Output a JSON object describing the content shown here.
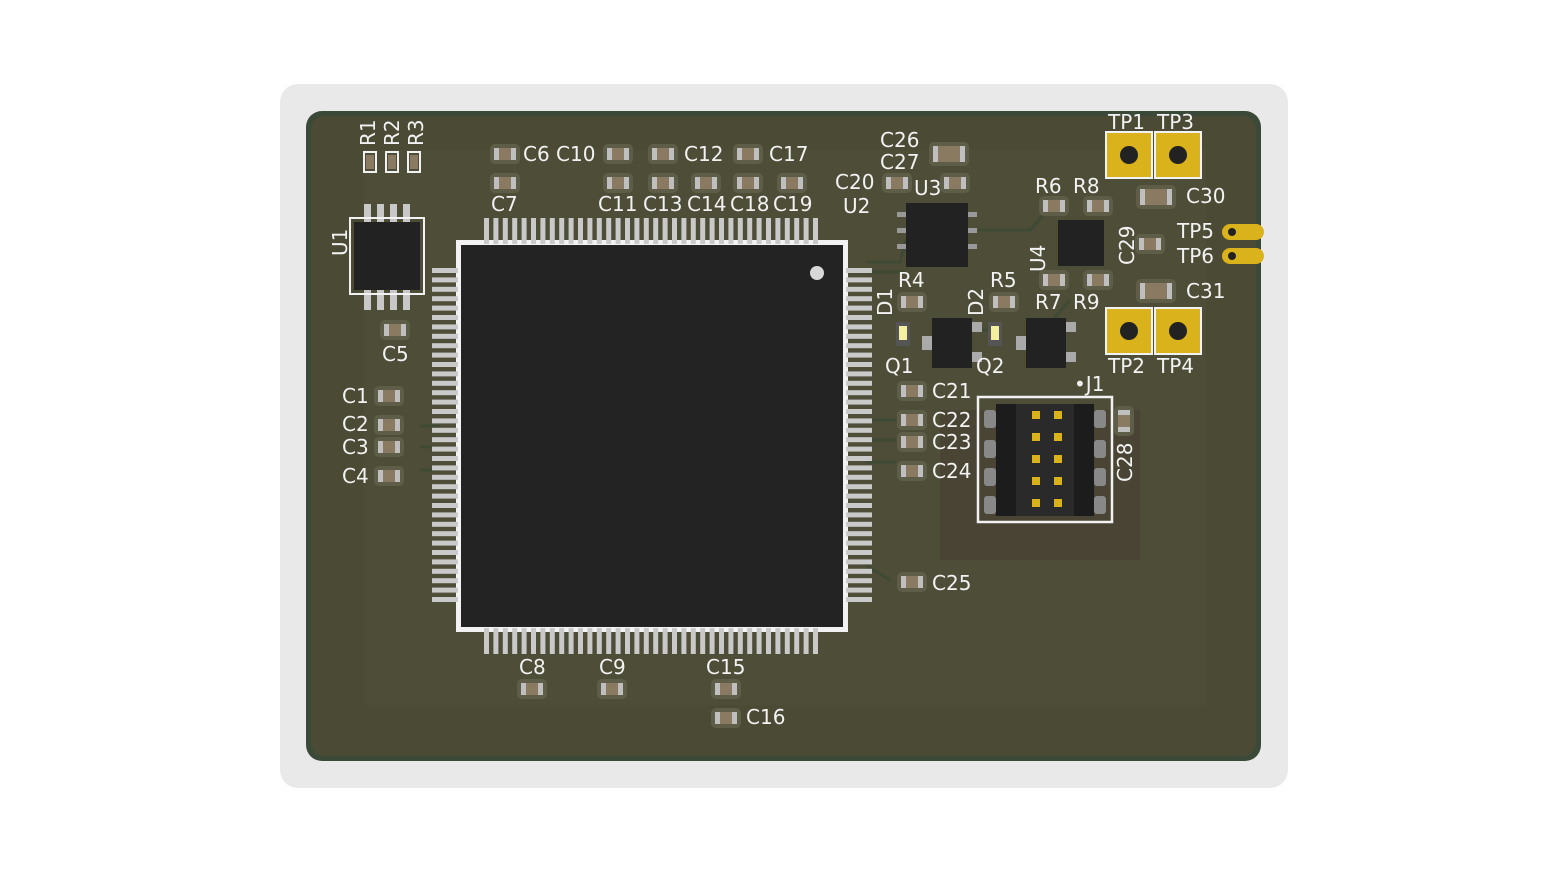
{
  "board": {
    "colors": {
      "background": "#ffffff",
      "shadow": "#e9e9e9",
      "soldermask": "#4a4a35",
      "mask_edge": "#3b4a38",
      "silkscreen": "#f2f2f2",
      "ic_body": "#222222",
      "copper_pad": "#d9b21c",
      "capacitor_body": "#8a7a62"
    },
    "designators": {
      "R1": "R1",
      "R2": "R2",
      "R3": "R3",
      "U1": "U1",
      "U2": "U2",
      "U3": "U3",
      "U4": "U4",
      "C1": "C1",
      "C2": "C2",
      "C3": "C3",
      "C4": "C4",
      "C5": "C5",
      "C6": "C6",
      "C7": "C7",
      "C8": "C8",
      "C9": "C9",
      "C10": "C10",
      "C11": "C11",
      "C12": "C12",
      "C13": "C13",
      "C14": "C14",
      "C15": "C15",
      "C16": "C16",
      "C17": "C17",
      "C18": "C18",
      "C19": "C19",
      "C20": "C20",
      "C21": "C21",
      "C22": "C22",
      "C23": "C23",
      "C24": "C24",
      "C25": "C25",
      "C26": "C26",
      "C27": "C27",
      "C28": "C28",
      "C29": "C29",
      "C30": "C30",
      "C31": "C31",
      "R4": "R4",
      "R5": "R5",
      "R6": "R6",
      "R7": "R7",
      "R8": "R8",
      "R9": "R9",
      "D1": "D1",
      "D2": "D2",
      "Q1": "Q1",
      "Q2": "Q2",
      "J1": "•J1",
      "TP1": "TP1",
      "TP2": "TP2",
      "TP3": "TP3",
      "TP4": "TP4",
      "TP5": "TP5",
      "TP6": "TP6"
    }
  }
}
